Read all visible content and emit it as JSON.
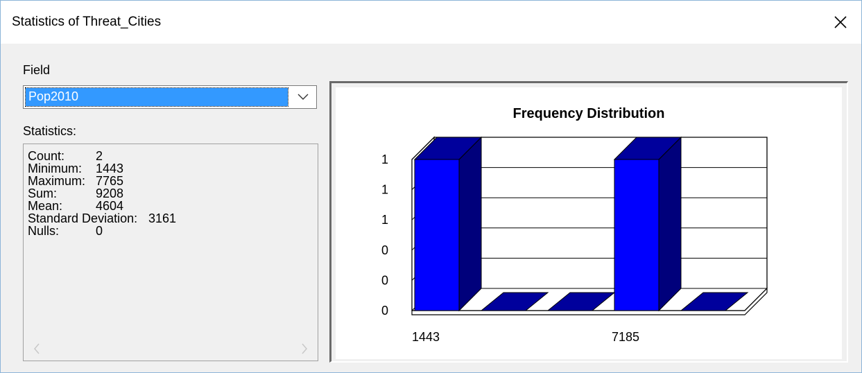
{
  "window": {
    "title": "Statistics of Threat_Cities"
  },
  "field": {
    "label": "Field",
    "selected": "Pop2010"
  },
  "statistics": {
    "label": "Statistics:",
    "rows": [
      {
        "name": "Count:",
        "value": "2"
      },
      {
        "name": "Minimum:",
        "value": "1443"
      },
      {
        "name": "Maximum:",
        "value": "7765"
      },
      {
        "name": "Sum:",
        "value": "9208"
      },
      {
        "name": "Mean:",
        "value": "4604"
      },
      {
        "name": "Standard Deviation:",
        "value": "3161"
      },
      {
        "name": "Nulls:",
        "value": "0"
      }
    ]
  },
  "icons": {
    "close": "close-icon",
    "dropdown": "chevron-down-icon",
    "scroll_left": "scroll-left-icon",
    "scroll_right": "scroll-right-icon"
  },
  "chart_data": {
    "type": "bar",
    "title": "Frequency Distribution",
    "categories": [
      "1443",
      "",
      "",
      "7185",
      ""
    ],
    "values": [
      1,
      0,
      0,
      1,
      0
    ],
    "y_tick_labels": [
      "0",
      "0",
      "0",
      "1",
      "1",
      "1"
    ],
    "x_tick_labels": [
      "1443",
      "7185"
    ],
    "ylim": [
      0,
      1
    ],
    "grid": true,
    "style": "3d",
    "colors": {
      "bar_front": "#0000ff",
      "bar_side": "#00007b",
      "bar_top": "#00009c"
    }
  }
}
